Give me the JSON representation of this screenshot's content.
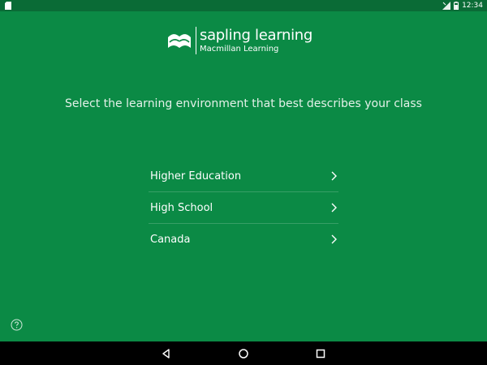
{
  "status_bar": {
    "time": "12:34"
  },
  "logo": {
    "name": "sapling learning",
    "subtitle": "Macmillan Learning"
  },
  "prompt": "Select the learning environment that best describes your class",
  "options": [
    {
      "label": "Higher Education"
    },
    {
      "label": "High School"
    },
    {
      "label": "Canada"
    }
  ],
  "icons": {
    "status_left": "sd-card-icon",
    "status_signal": "signal-icon",
    "status_battery": "battery-icon",
    "chevron": "chevron-right-icon",
    "help": "help-circle-icon",
    "nav_back": "back-icon",
    "nav_home": "home-icon",
    "nav_recents": "recents-icon"
  },
  "colors": {
    "background": "#0b8a45",
    "status_bar": "#0a6b36",
    "nav_bar": "#000000",
    "text": "#ffffff"
  }
}
